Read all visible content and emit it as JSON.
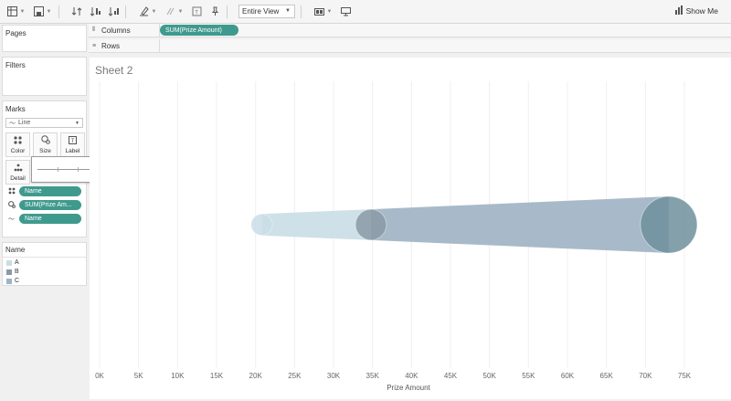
{
  "toolbar": {
    "view_select": "Entire View",
    "show_me": "Show Me",
    "icons": [
      "table-icon",
      "save-icon",
      "swap-icon",
      "sort-ascending-icon",
      "sort-descending-icon",
      "highlight-icon",
      "group-icon",
      "label-icon",
      "pin-icon",
      "fit-icon",
      "presentation-icon",
      "show-me-icon"
    ]
  },
  "panels": {
    "pages": "Pages",
    "filters": "Filters",
    "marks": "Marks",
    "mark_type": "Line",
    "buttons": {
      "color": "Color",
      "size": "Size",
      "label": "Label",
      "detail": "Detail"
    },
    "mark_pills": [
      {
        "icon": "color-dots-icon",
        "label": "Name"
      },
      {
        "icon": "size-icon",
        "label": "SUM(Prize Am..."
      },
      {
        "icon": "path-icon",
        "label": "Name"
      }
    ]
  },
  "legend": {
    "title": "Name",
    "items": [
      {
        "label": "A",
        "color": "#c9dde6"
      },
      {
        "label": "B",
        "color": "#8a9aa6"
      },
      {
        "label": "C",
        "color": "#9fb3c3"
      }
    ]
  },
  "shelves": {
    "columns_label": "Columns",
    "columns_pill": "SUM(Prize Amount)",
    "rows_label": "Rows"
  },
  "sheet": {
    "title": "Sheet 2"
  },
  "colors": {
    "pill": "#3f9a8e",
    "accent": "#3f9a8e"
  },
  "chart_data": {
    "type": "line",
    "xlabel": "Prize Amount",
    "ylabel": "",
    "xlim": [
      0,
      75000
    ],
    "x_ticks": [
      "0K",
      "5K",
      "10K",
      "15K",
      "20K",
      "25K",
      "30K",
      "35K",
      "40K",
      "45K",
      "50K",
      "55K",
      "60K",
      "65K",
      "70K",
      "75K"
    ],
    "x_tick_values": [
      0,
      5000,
      10000,
      15000,
      20000,
      25000,
      30000,
      35000,
      40000,
      45000,
      50000,
      55000,
      60000,
      65000,
      70000,
      75000
    ],
    "grid": true,
    "points": [
      {
        "name": "A",
        "x": 20800,
        "size": 20800,
        "color": "#c9dde6"
      },
      {
        "name": "B",
        "x": 34800,
        "size": 34800,
        "color": "#8a9aa6"
      },
      {
        "name": "C",
        "x": 73000,
        "size": 73000,
        "color": "#6f8f9c"
      }
    ],
    "segments": [
      {
        "from": "A",
        "to": "B",
        "color": "#c9dde6"
      },
      {
        "from": "B",
        "to": "C",
        "color": "#9fb3c3"
      }
    ]
  }
}
